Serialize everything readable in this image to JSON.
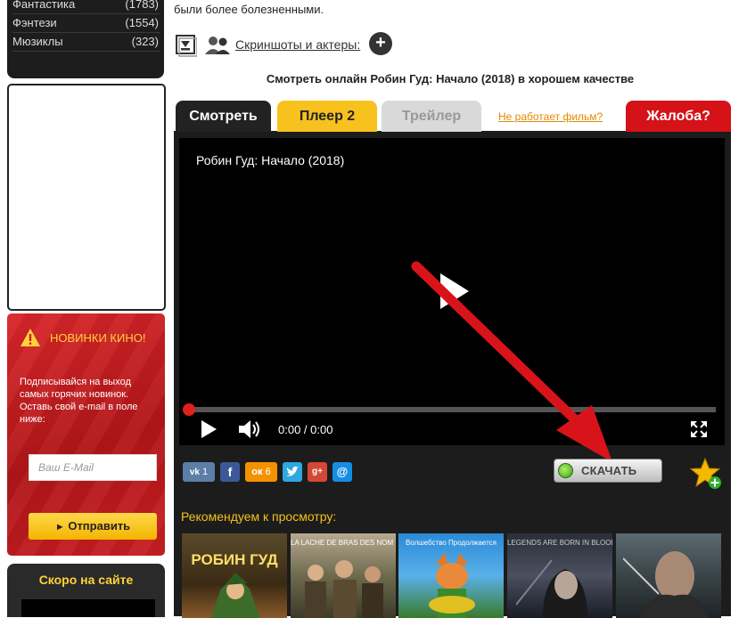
{
  "sidebar": {
    "genres": [
      {
        "name": "Фантастика",
        "count": "(1783)"
      },
      {
        "name": "Фэнтези",
        "count": "(1554)"
      },
      {
        "name": "Мюзиклы",
        "count": "(323)"
      }
    ],
    "newsletter": {
      "title": "НОВИНКИ КИНО!",
      "description": "Подписывайся на выход самых горячих новинок. Оставь свой e-mail в поле ниже:",
      "email_placeholder": "Ваш E-Mail",
      "submit_label": "Отправить"
    },
    "soon": {
      "title": "Скоро на сайте"
    }
  },
  "main": {
    "description_tail": "были более болезненными.",
    "screenshots_link": "Скриншоты и актеры:",
    "plus_label": "+",
    "watch_title": "Смотреть онлайн Робин Гуд: Начало (2018) в хорошем качестве",
    "tabs": [
      {
        "label": "Смотреть"
      },
      {
        "label": "Плеер 2"
      },
      {
        "label": "Трейлер"
      }
    ],
    "not_working": "Не работает фильм?",
    "complain_label": "Жалоба?",
    "player": {
      "title": "Робин Гуд: Начало (2018)",
      "time": "0:00 / 0:00",
      "progress": 0
    },
    "share": {
      "vk_count": "1",
      "ok_count": "6"
    },
    "download_label": "СКАЧАТЬ",
    "recommend_label": "Рекомендуем к просмотру:",
    "posters": [
      {
        "caption": "",
        "title": "РОБИН ГУД"
      },
      {
        "caption": "LA LACHE DE BRAS DES NOM !",
        "title": ""
      },
      {
        "caption": "Волшебство Продолжается",
        "title": ""
      },
      {
        "caption": "LEGENDS ARE BORN IN BLOOD",
        "title": ""
      },
      {
        "caption": "",
        "title": ""
      }
    ]
  },
  "colors": {
    "accent_yellow": "#f7c21e",
    "complain_red": "#d41218",
    "dark": "#1c1c1c"
  }
}
